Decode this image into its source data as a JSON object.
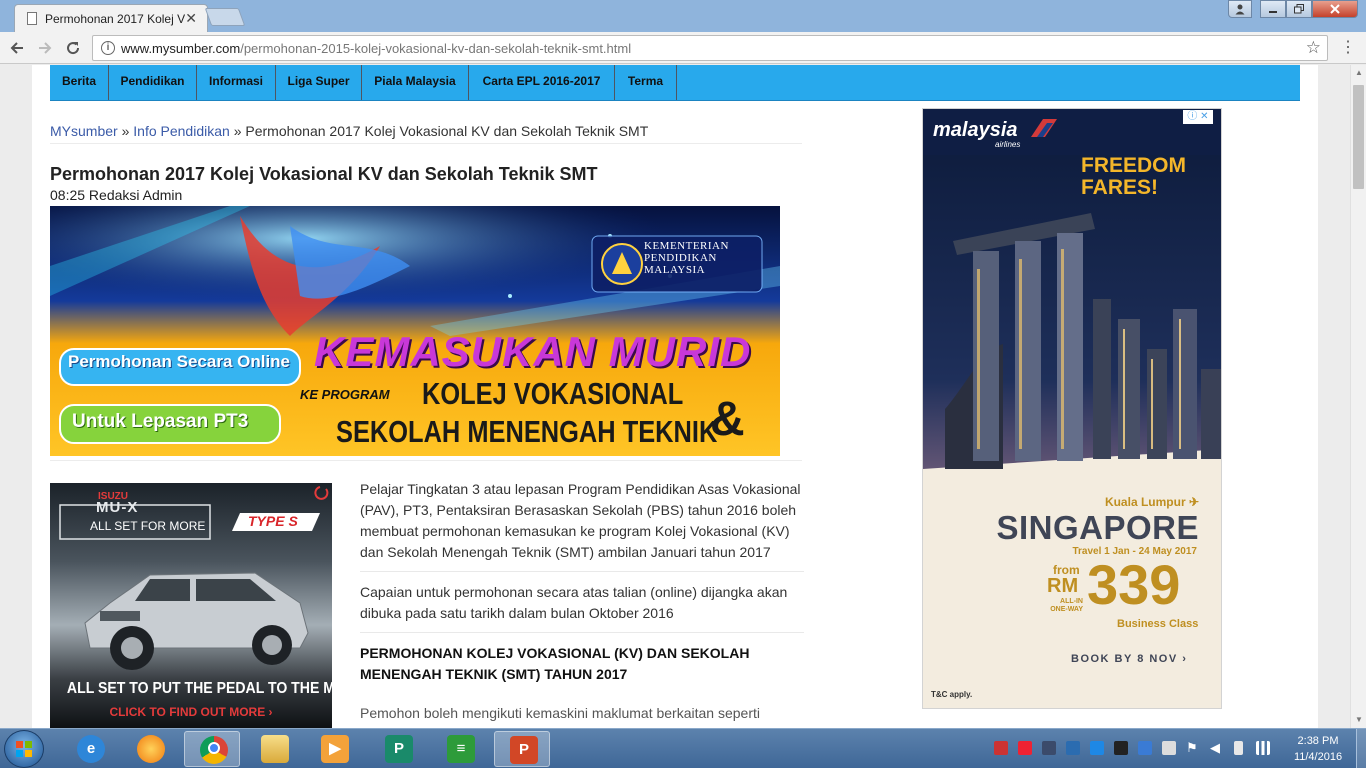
{
  "browser": {
    "tab_title": "Permohonan 2017 Kolej V",
    "tab_close": "✕",
    "url_host": "www.mysumber.com",
    "url_path": "/permohonan-2015-kolej-vokasional-kv-dan-sekolah-teknik-smt.html"
  },
  "site_nav": {
    "items": [
      "Berita",
      "Pendidikan",
      "Informasi",
      "Liga Super",
      "Piala Malaysia",
      "Carta EPL 2016-2017",
      "Terma"
    ]
  },
  "breadcrumb": {
    "home": "MYsumber",
    "sep1": "»",
    "category": "Info Pendidikan",
    "sep2": "»",
    "current": "Permohonan 2017 Kolej Vokasional KV dan Sekolah Teknik SMT"
  },
  "post": {
    "title": "Permohonan 2017 Kolej Vokasional KV dan Sekolah Teknik SMT",
    "meta": "08:25 Redaksi Admin",
    "hero": {
      "ministry_line1": "KEMENTERIAN",
      "ministry_line2": "PENDIDIKAN",
      "ministry_line3": "MALAYSIA",
      "pill1": "Permohonan Secara Online",
      "pill2": "Untuk Lepasan PT3",
      "headline": "KEMASUKAN MURID",
      "ke_program": "KE PROGRAM",
      "line2": "KOLEJ VOKASIONAL",
      "amp": "&",
      "line3": "SEKOLAH MENENGAH TEKNIK"
    },
    "para1": "Pelajar Tingkatan 3 atau lepasan Program Pendidikan Asas Vokasional (PAV), PT3, Pentaksiran Berasaskan Sekolah (PBS) tahun 2016 boleh membuat permohonan kemasukan ke program Kolej Vokasional (KV) dan Sekolah Menengah Teknik (SMT) ambilan Januari tahun 2017",
    "para2": "Capaian untuk permohonan secara atas talian (online) dijangka akan dibuka pada satu tarikh dalam bulan Oktober 2016",
    "heading": "PERMOHONAN KOLEJ VOKASIONAL (KV) DAN SEKOLAH MENENGAH TEKNIK (SMT) TAHUN 2017",
    "para3": "Pemohon boleh mengikuti kemaskini maklumat berkaitan seperti"
  },
  "car_ad": {
    "brand": "ISUZU",
    "model": "MU-X",
    "tagline": "ALL SET FOR MORE",
    "badge": "TYPE S",
    "slogan": "ALL SET TO PUT THE PEDAL TO THE METAL",
    "cta": "CLICK TO FIND OUT MORE ›"
  },
  "mas_ad": {
    "logo": "malaysia",
    "logo_sub": "airlines",
    "headline1": "FREEDOM",
    "headline2": "FARES!",
    "origin": "Kuala Lumpur ✈",
    "destination": "SINGAPORE",
    "travel_dates": "Travel 1 Jan - 24 May 2017",
    "from": "from",
    "currency": "RM",
    "allin1": "ALL-IN",
    "allin2": "ONE-WAY",
    "price": "339",
    "cabin": "Business Class",
    "cta": "BOOK BY 8 NOV ›",
    "tnc": "T&C apply."
  },
  "taskbar": {
    "time": "2:38 PM",
    "date": "11/4/2016",
    "apps": [
      "internet-explorer",
      "media-app",
      "chrome",
      "file-explorer",
      "media-player",
      "publisher",
      "notepad-app",
      "powerpoint"
    ]
  }
}
